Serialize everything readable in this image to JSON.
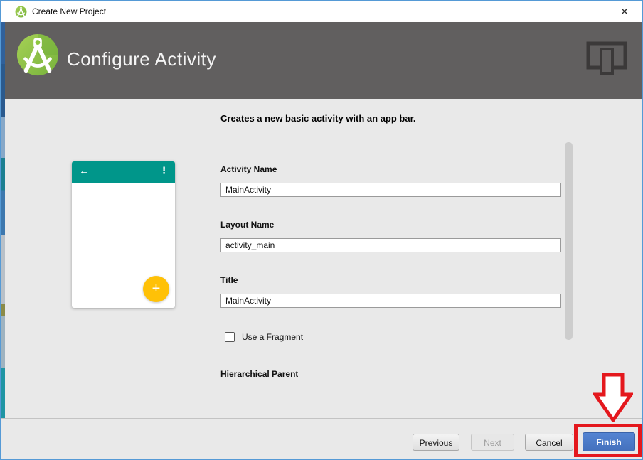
{
  "window": {
    "title": "Create New Project",
    "close_icon_glyph": "✕"
  },
  "header": {
    "title": "Configure Activity"
  },
  "content": {
    "description": "Creates a new basic activity with an app bar.",
    "preview": {
      "back_icon_glyph": "←",
      "menu_icon_glyph": "⋮",
      "fab_icon_glyph": "+"
    },
    "fields": [
      {
        "label": "Activity Name",
        "value": "MainActivity"
      },
      {
        "label": "Layout Name",
        "value": "activity_main"
      },
      {
        "label": "Title",
        "value": "MainActivity"
      }
    ],
    "checkbox": {
      "label": "Use a Fragment",
      "checked": false
    },
    "clipped_label": "Hierarchical Parent"
  },
  "footer": {
    "previous_label": "Previous",
    "next_label": "Next",
    "next_disabled": true,
    "cancel_label": "Cancel",
    "finish_label": "Finish"
  },
  "colors": {
    "header_gray": "#615f5f",
    "appbar_teal": "#00968a",
    "fab_yellow": "#ffc107",
    "finish_blue": "#4a7bc9",
    "annotation_red": "#e4181d",
    "window_border_blue": "#559ad6"
  }
}
